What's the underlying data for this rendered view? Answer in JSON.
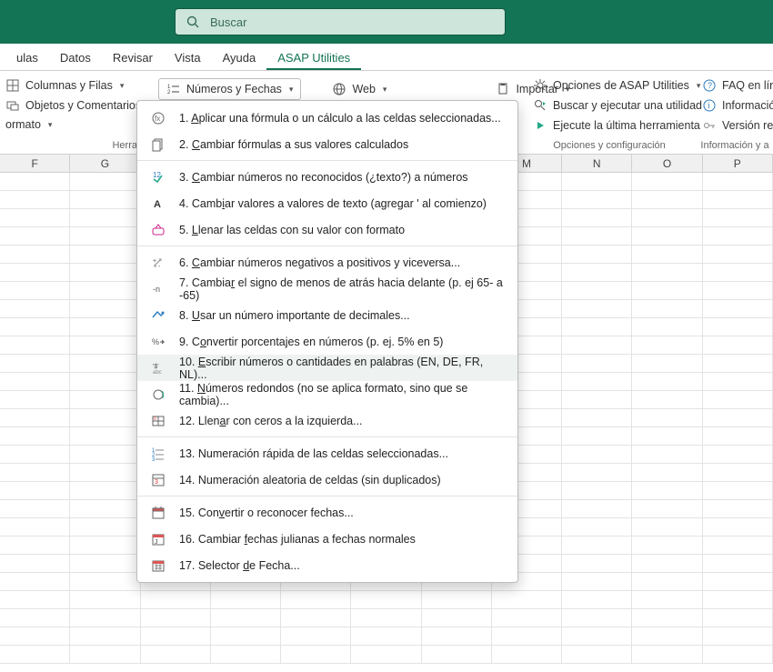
{
  "search_placeholder": "Buscar",
  "tabs": [
    "ulas",
    "Datos",
    "Revisar",
    "Vista",
    "Ayuda",
    "ASAP Utilities"
  ],
  "active_tab": "ASAP Utilities",
  "ribbon": {
    "g1": {
      "btn1": "Columnas y Filas",
      "btn2": "Objetos y Comentarios",
      "btn3": "ormato",
      "label": "Herra"
    },
    "g2": {
      "numbers": "Números y Fechas",
      "web": "Web",
      "import": "Importar"
    },
    "g3": {
      "options": "Opciones de ASAP Utilities",
      "search": "Buscar y ejecutar una utilidad",
      "last": "Ejecute la última herramienta",
      "config": "Opciones y configuración"
    },
    "g4": {
      "faq": "FAQ en línea",
      "info": "Información",
      "version": "Versión reg",
      "label": "Información y a"
    }
  },
  "columns": [
    "F",
    "G",
    "",
    "",
    "",
    "",
    "",
    "M",
    "N",
    "O",
    "P"
  ],
  "row_count": 27,
  "menu": [
    {
      "n": "1",
      "txt": "Aplicar una fórmula o un cálculo a las celdas seleccionadas...",
      "u": "A"
    },
    {
      "n": "2",
      "txt": "Cambiar fórmulas a sus valores calculados",
      "u": "C"
    },
    {
      "sep": true
    },
    {
      "n": "3",
      "txt": "Cambiar números no reconocidos (¿texto?) a números",
      "u": "C"
    },
    {
      "n": "4",
      "txt": "Cambiar valores a valores de texto (agregar ' al comienzo)",
      "u": "i"
    },
    {
      "n": "5",
      "txt": "Llenar las celdas con su valor con formato",
      "u": "L"
    },
    {
      "sep": true
    },
    {
      "n": "6",
      "txt": "Cambiar números negativos a positivos y viceversa...",
      "u": "C"
    },
    {
      "n": "7",
      "txt": "Cambiar el signo de menos de atrás hacia delante (p. ej 65- a -65)",
      "u": "r"
    },
    {
      "n": "8",
      "txt": "Usar un número importante de decimales...",
      "u": "U"
    },
    {
      "n": "9",
      "txt": "Convertir porcentajes en números (p. ej. 5% en 5)",
      "u": "o"
    },
    {
      "n": "10",
      "txt": "Escribir números o cantidades en palabras (EN, DE, FR, NL)...",
      "u": "E",
      "hl": true
    },
    {
      "n": "11",
      "txt": "Números redondos (no se aplica formato, sino que se cambia)...",
      "u": "N"
    },
    {
      "n": "12",
      "txt": "Llenar con ceros a la izquierda...",
      "u": "a"
    },
    {
      "sep": true
    },
    {
      "n": "13",
      "txt": "Numeración rápida de las celdas seleccionadas..."
    },
    {
      "n": "14",
      "txt": "Numeración aleatoria de celdas (sin duplicados)"
    },
    {
      "sep": true
    },
    {
      "n": "15",
      "txt": "Convertir o reconocer fechas...",
      "u": "v"
    },
    {
      "n": "16",
      "txt": "Cambiar fechas julianas a fechas normales",
      "u": "f"
    },
    {
      "n": "17",
      "txt": "Selector de Fecha...",
      "u": "d"
    }
  ]
}
